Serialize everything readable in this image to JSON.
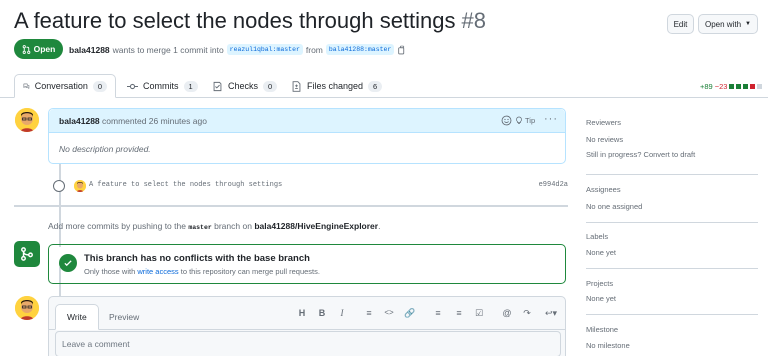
{
  "header": {
    "title": "A feature to select the nodes through settings",
    "number": "#8",
    "edit_label": "Edit",
    "open_with_label": "Open with"
  },
  "state": {
    "label": "Open",
    "author": "bala41288",
    "action_text": "wants to merge 1 commit into",
    "base_branch": "reazul1qbal:master",
    "from_text": "from",
    "head_branch": "bala41288:master"
  },
  "tabs": [
    {
      "label": "Conversation",
      "count": "0"
    },
    {
      "label": "Commits",
      "count": "1"
    },
    {
      "label": "Checks",
      "count": "0"
    },
    {
      "label": "Files changed",
      "count": "6"
    }
  ],
  "diffstat": {
    "additions": "+89",
    "deletions": "−23"
  },
  "comment": {
    "author": "bala41288",
    "time_text": "commented 26 minutes ago",
    "tip_label": "Tip",
    "body": "No description provided."
  },
  "commit": {
    "message": "A feature to select the nodes through settings",
    "sha": "e994d2a"
  },
  "add_more": {
    "prefix": "Add more commits by pushing to the",
    "branch": "master",
    "middle": "branch on",
    "repo": "bala41288/HiveEngineExplorer",
    "suffix": "."
  },
  "merge": {
    "title": "This branch has no conflicts with the base branch",
    "sub_prefix": "Only those with",
    "sub_link": "write access",
    "sub_suffix": "to this repository can merge pull requests."
  },
  "editor": {
    "write_tab": "Write",
    "preview_tab": "Preview",
    "placeholder": "Leave a comment"
  },
  "sidebar": {
    "reviewers_label": "Reviewers",
    "reviewers_value": "No reviews",
    "reviewers_note": "Still in progress? Convert to draft",
    "assignees_label": "Assignees",
    "assignees_value": "No one assigned",
    "labels_label": "Labels",
    "labels_value": "None yet",
    "projects_label": "Projects",
    "projects_value": "None yet",
    "milestone_label": "Milestone",
    "milestone_value": "No milestone"
  },
  "colors": {
    "open_green": "#1f883d",
    "link_blue": "#0969da",
    "comment_header": "#ddf4ff",
    "deletion_red": "#cf222e"
  },
  "icons": [
    "git-pull-request-icon",
    "copy-icon",
    "comment-discussion-icon",
    "git-commit-icon",
    "checklist-icon",
    "file-diff-icon",
    "smiley-icon",
    "light-bulb-icon",
    "kebab-icon",
    "git-merge-icon",
    "check-icon",
    "heading-icon",
    "bold-icon",
    "italic-icon",
    "quote-icon",
    "code-icon",
    "link-icon",
    "list-unordered-icon",
    "list-ordered-icon",
    "tasklist-icon",
    "mention-icon",
    "cross-reference-icon",
    "reply-icon"
  ]
}
